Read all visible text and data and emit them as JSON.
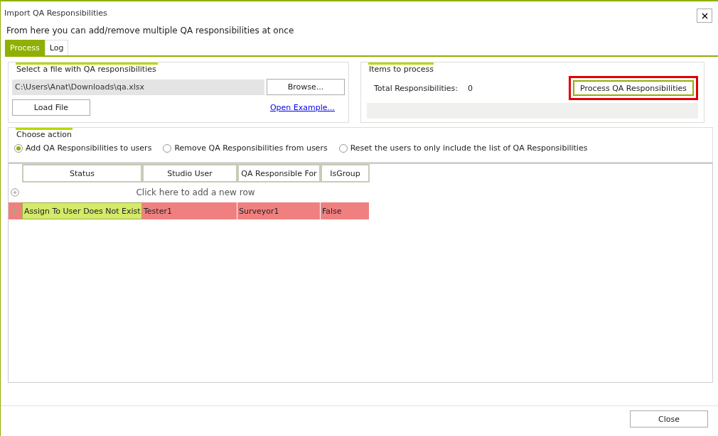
{
  "window": {
    "title": "Import QA Responsibilities"
  },
  "subtitle": "From here you can add/remove multiple QA responsibilities at once",
  "tabs": [
    {
      "label": "Process",
      "selected": true
    },
    {
      "label": "Log",
      "selected": false
    }
  ],
  "file_panel": {
    "title": "Select a file with QA responsibilities",
    "path": "C:\\Users\\Anat\\Downloads\\qa.xlsx",
    "browse": "Browse...",
    "load": "Load File",
    "example_link": "Open Example..."
  },
  "items_panel": {
    "title": "Items to process",
    "total_label": "Total Responsibilities:",
    "total_value": "0",
    "process_button": "Process QA Responsibilities",
    "highlighted": true,
    "progress": {
      "level": 0
    }
  },
  "action_panel": {
    "title": "Choose action",
    "options": [
      {
        "label": "Add QA Responsibilities to users",
        "selected": true
      },
      {
        "label": "Remove QA Responsibilities  from users",
        "selected": false
      },
      {
        "label": "Reset the users to only include the list of QA Responsibilities",
        "selected": false
      }
    ]
  },
  "table": {
    "columns": [
      "Status",
      "Studio User",
      "QA Responsible For",
      "IsGroup"
    ],
    "new_row": "Click here to add a new row",
    "rows": [
      {
        "cells": [
          "Assign To User Does Not Exist",
          "Tester1",
          "Surveyor1",
          "False"
        ],
        "selected": true,
        "error": true
      }
    ]
  },
  "footer": {
    "close": "Close"
  }
}
